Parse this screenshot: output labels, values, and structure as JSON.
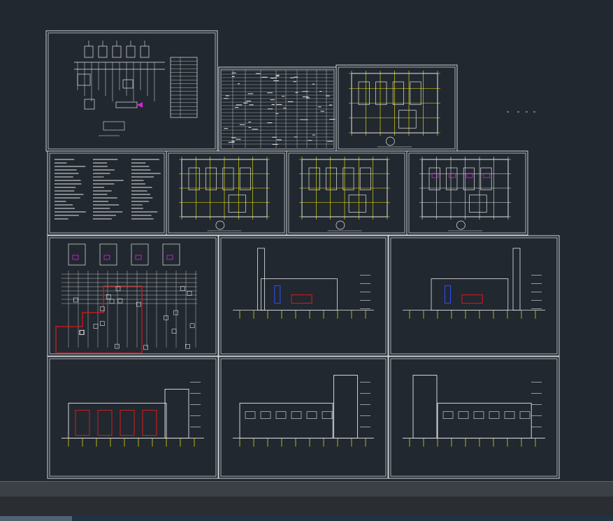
{
  "colors": {
    "background": "#212830",
    "sheet_border": "#cfd3d6",
    "white_lines": "#e6e6e6",
    "yellow_lines": "#f4f000",
    "red_lines": "#e01818",
    "magenta": "#e020e0",
    "blue": "#3050ff",
    "cyan": "#20d0e0"
  },
  "sheets": [
    {
      "id": "system-schematic"
    },
    {
      "id": "equipment-table"
    },
    {
      "id": "floor-plan-yellow-1"
    },
    {
      "id": "design-notes"
    },
    {
      "id": "floor-plan-2"
    },
    {
      "id": "floor-plan-3"
    },
    {
      "id": "floor-plan-4"
    },
    {
      "id": "piping-schematic-red"
    },
    {
      "id": "section-1"
    },
    {
      "id": "section-2"
    },
    {
      "id": "elevation-1"
    },
    {
      "id": "elevation-2"
    },
    {
      "id": "elevation-3"
    }
  ],
  "status": {
    "model_tab": ""
  }
}
